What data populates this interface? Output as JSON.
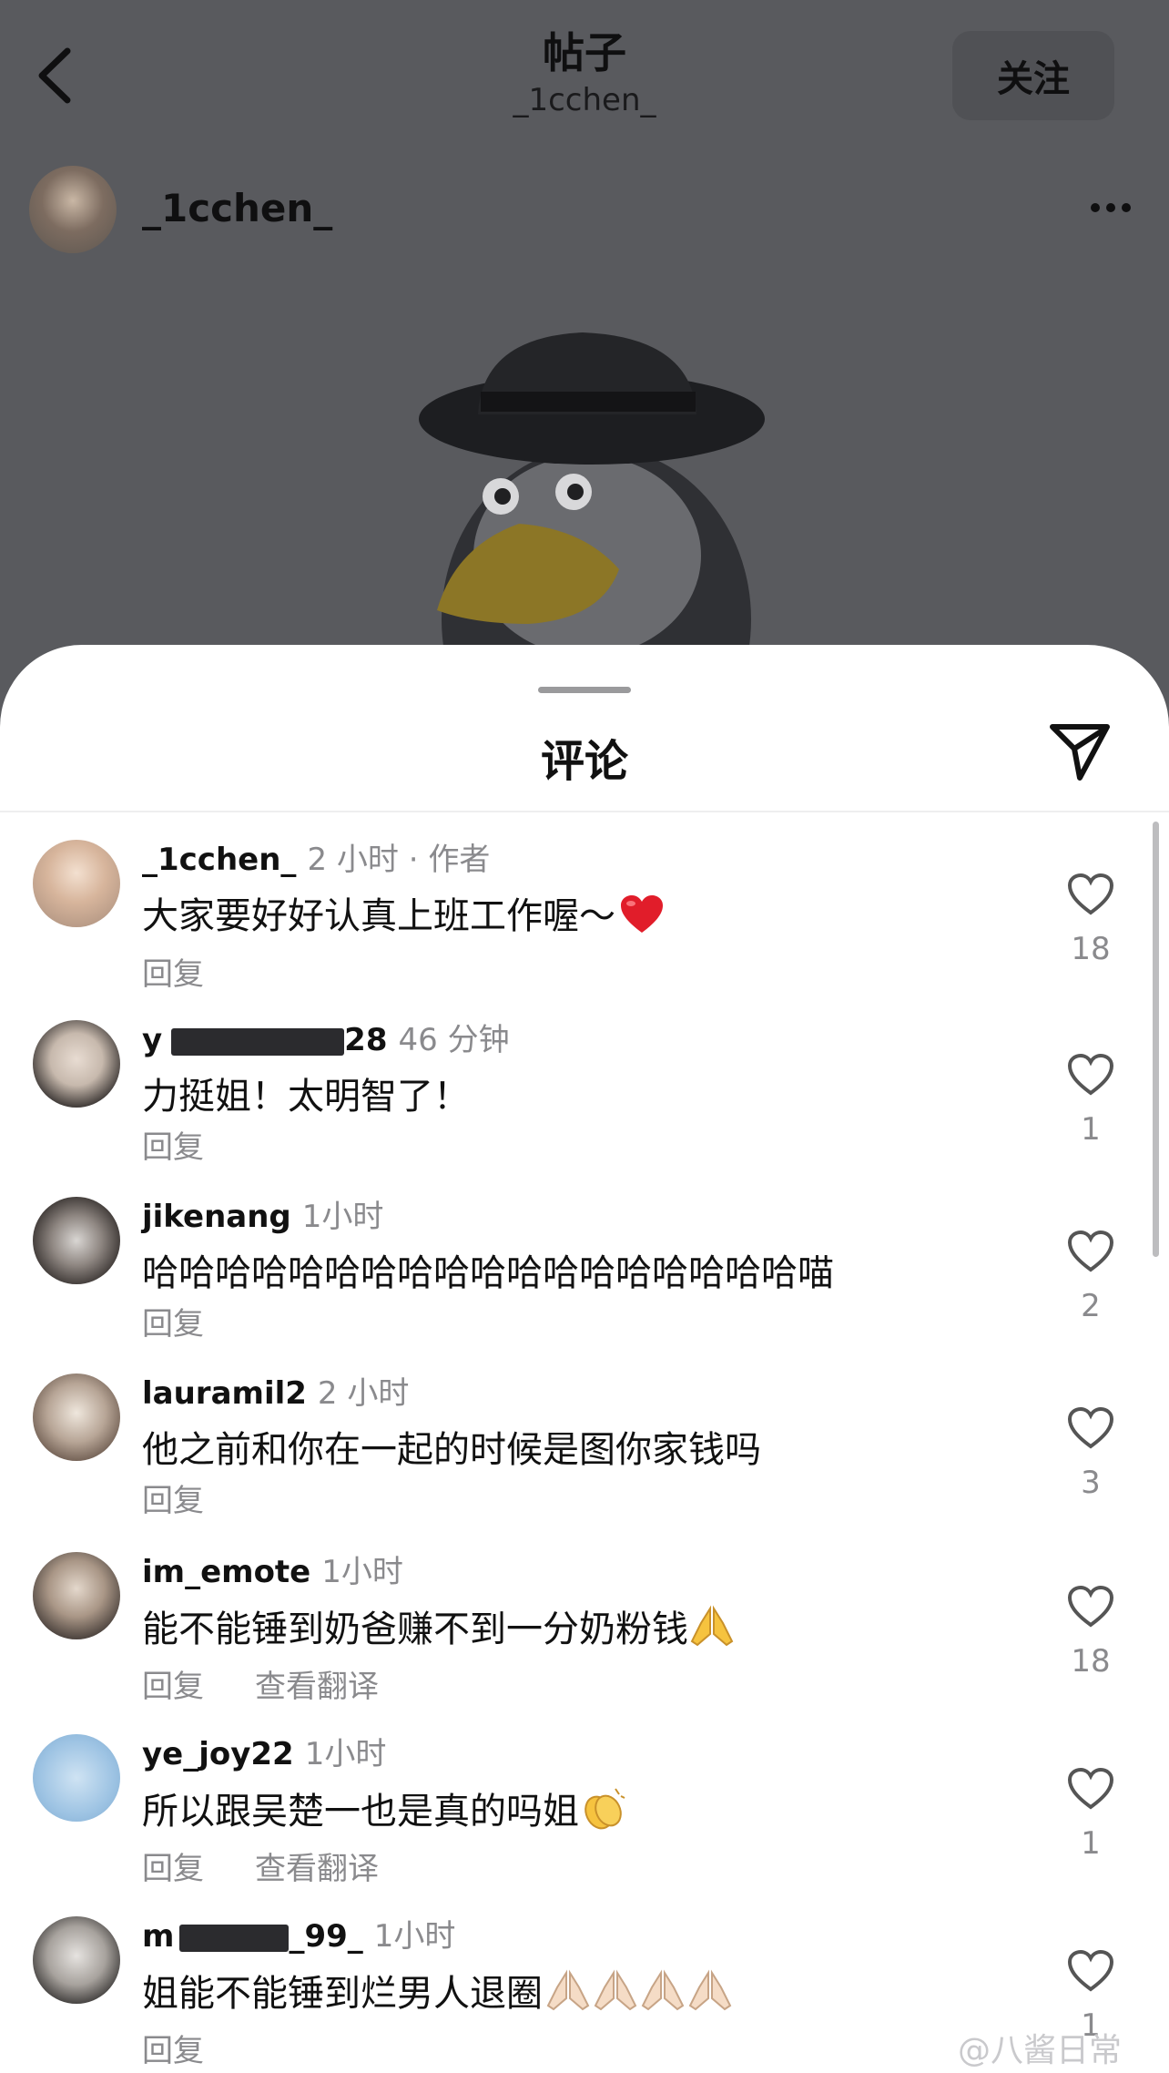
{
  "header": {
    "title": "帖子",
    "subtitle": "_1cchen_",
    "follow_label": "关注"
  },
  "post": {
    "author": "_1cchen_"
  },
  "sheet": {
    "title": "评论"
  },
  "comments": [
    {
      "user": "_1cchen_",
      "time": "2 小时",
      "badge": " · 作者",
      "text": "大家要好好认真上班工作喔～",
      "emoji": "heart",
      "actions": [
        "回复"
      ],
      "likes": "18"
    },
    {
      "user_prefix": "y",
      "user_suffix": "28",
      "time": "46 分钟",
      "text": "力挺姐！太明智了！",
      "actions": [
        "回复"
      ],
      "likes": "1"
    },
    {
      "user": "jikenang",
      "time": "1小时",
      "text": "哈哈哈哈哈哈哈哈哈哈哈哈哈哈哈哈哈哈喵",
      "actions": [
        "回复"
      ],
      "likes": "2"
    },
    {
      "user": "lauramil2",
      "time": "2 小时",
      "text": "他之前和你在一起的时候是图你家钱吗",
      "actions": [
        "回复"
      ],
      "likes": "3"
    },
    {
      "user": "im_emote",
      "time": "1小时",
      "text": "能不能锤到奶爸赚不到一分奶粉钱",
      "emoji": "pray",
      "actions": [
        "回复",
        "查看翻译"
      ],
      "likes": "18"
    },
    {
      "user": "ye_joy22",
      "time": "1小时",
      "text": "所以跟吴楚一也是真的吗姐",
      "emoji": "clap",
      "actions": [
        "回复",
        "查看翻译"
      ],
      "likes": "1"
    },
    {
      "user_prefix": "m",
      "user_suffix": "_99_",
      "time": "1小时",
      "text": "姐能不能锤到烂男人退圈",
      "emoji": "pray4",
      "actions": [
        "回复"
      ],
      "likes": "1"
    }
  ],
  "watermark": "@八酱日常",
  "colors": {
    "overlay": "#595a5e",
    "sheet": "#ffffff",
    "secondary_text": "#8a8a8d",
    "heart_red": "#e11d2a"
  }
}
